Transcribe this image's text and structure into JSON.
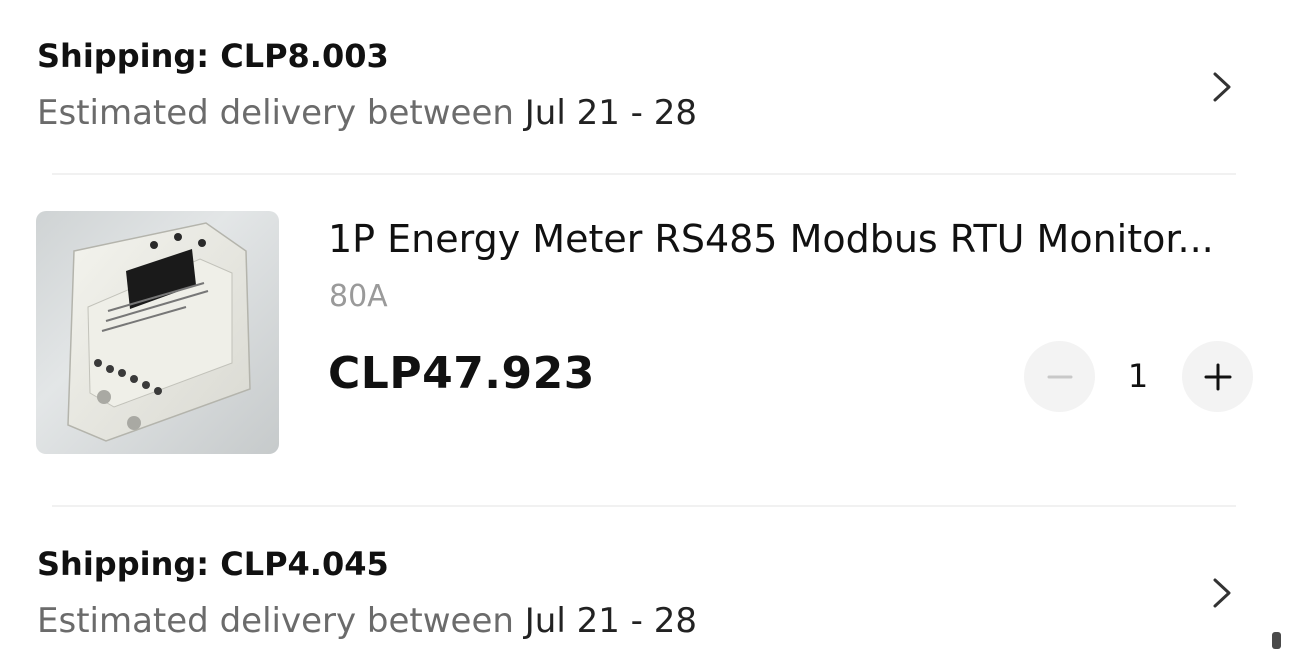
{
  "shipping_sections": [
    {
      "label": "Shipping: ",
      "amount": "CLP8.003",
      "eta_prefix": "Estimated delivery between ",
      "eta_dates": "Jul 21 - 28"
    },
    {
      "label": "Shipping: ",
      "amount": "CLP4.045",
      "eta_prefix": "Estimated delivery between ",
      "eta_dates": "Jul 21 - 28"
    }
  ],
  "product": {
    "title": "1P Energy Meter RS485 Modbus RTU Monitor...",
    "variant": "80A",
    "price": "CLP47.923",
    "quantity": "1",
    "image_icon": "energy-meter-photo"
  },
  "icons": {
    "chevron": "chevron-right-icon",
    "minus": "minus-icon",
    "plus": "plus-icon"
  },
  "colors": {
    "text_primary": "#111111",
    "text_secondary": "#6b6b6b",
    "text_variant": "#9a9a9a",
    "qty_button_bg": "#f3f3f3",
    "divider": "#f1f1f1"
  }
}
